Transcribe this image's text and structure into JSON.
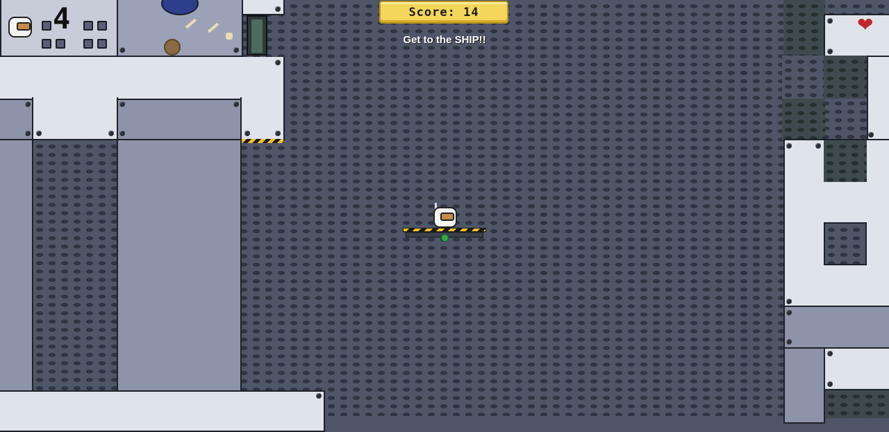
{
  "hud": {
    "score_label": "Score: 14",
    "message": "Get to the SHIP!!",
    "lives_count": "4"
  },
  "icons": {
    "heart": "heart-icon",
    "player": "astronaut-icon"
  },
  "colors": {
    "score_bg": "#f4d65a",
    "heart": "#c0262b",
    "platform_light": "#2fa93c"
  }
}
